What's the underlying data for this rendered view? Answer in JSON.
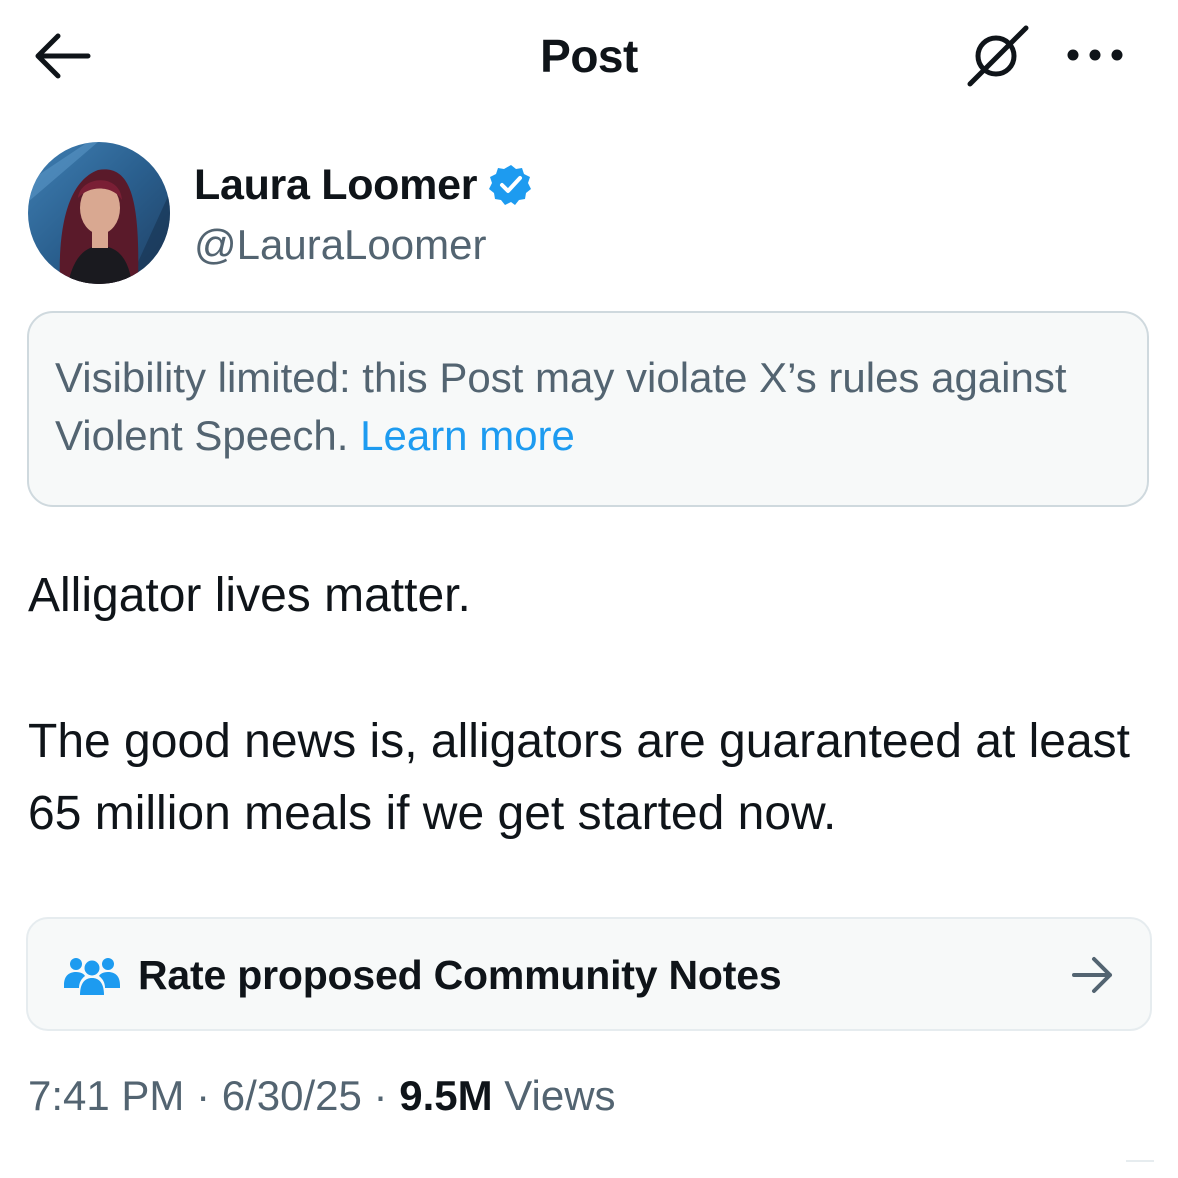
{
  "header": {
    "title": "Post",
    "back_icon": "arrow-left-icon",
    "grok_icon": "grok-icon",
    "more_icon": "more-horizontal-icon"
  },
  "author": {
    "name": "Laura Loomer",
    "handle": "@LauraLoomer",
    "verified": true,
    "verified_color": "#1d9bf0"
  },
  "notice": {
    "text": "Visibility limited: this Post may violate X’s rules against Violent Speech.",
    "link_label": "Learn more",
    "link_color": "#1d9bf0"
  },
  "post": {
    "paragraphs": [
      "Alligator lives matter.",
      "The good news is, alligators are guaranteed at least 65 million meals if we get started now."
    ]
  },
  "community_notes": {
    "label": "Rate proposed Community Notes",
    "icon": "people-icon",
    "icon_color": "#1d9bf0",
    "arrow_icon": "arrow-right-icon"
  },
  "meta": {
    "time": "7:41 PM",
    "separator": " · ",
    "date": "6/30/25",
    "views_count": "9.5M",
    "views_label": "Views"
  }
}
